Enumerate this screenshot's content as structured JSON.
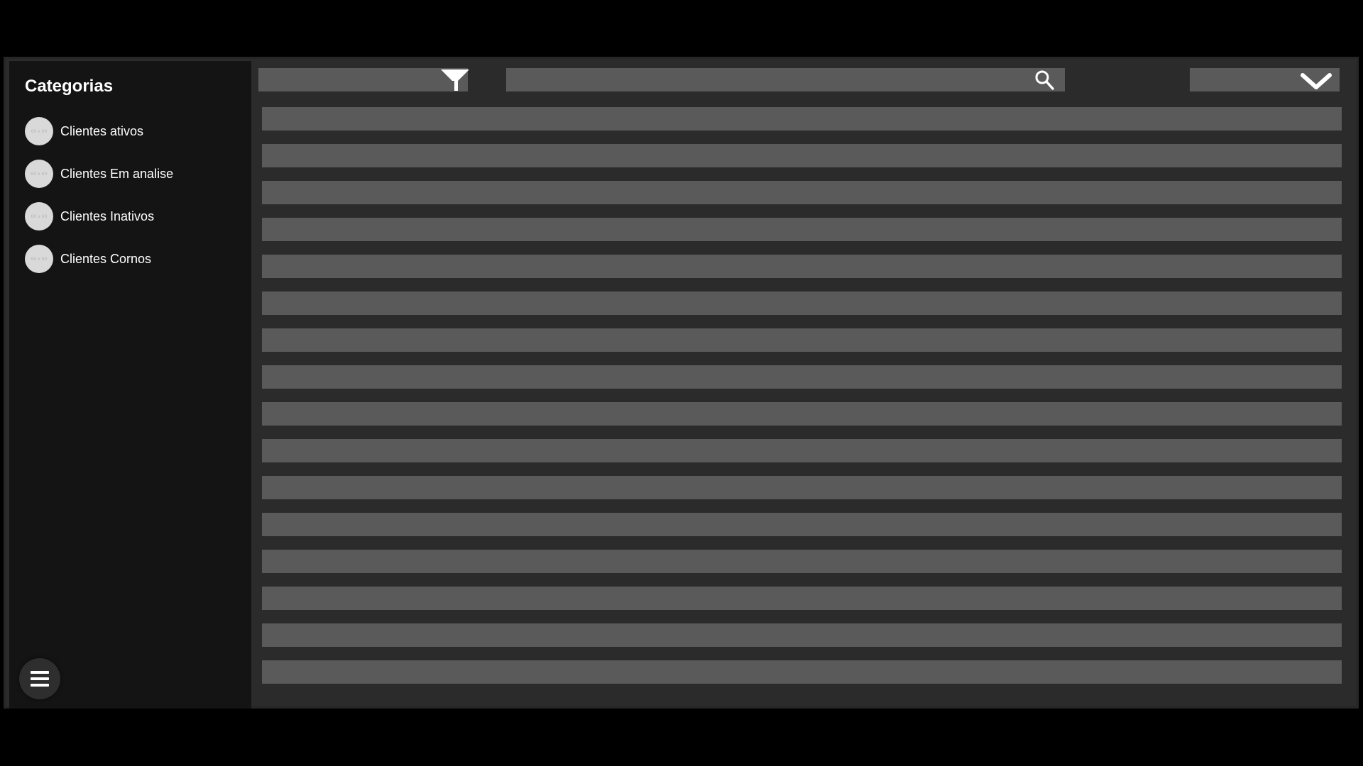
{
  "sidebar": {
    "title": "Categorias",
    "items": [
      {
        "label": "Clientes ativos",
        "avatar_text": "60 x 60"
      },
      {
        "label": "Clientes Em analise",
        "avatar_text": "60 x 60"
      },
      {
        "label": "Clientes Inativos",
        "avatar_text": "60 x 60"
      },
      {
        "label": "Clientes Cornos",
        "avatar_text": "60 x 60"
      }
    ],
    "menu_icon": "hamburger-menu-icon"
  },
  "toolbar": {
    "filter": {
      "value": "",
      "icon": "filter-icon"
    },
    "search": {
      "value": "",
      "icon": "search-icon"
    },
    "dropdown": {
      "value": "",
      "icon": "chevron-down-icon"
    }
  },
  "list": {
    "row_count": 16
  },
  "colors": {
    "page_background": "#000000",
    "app_background": "#2b2b2b",
    "sidebar_background": "#141414",
    "placeholder_bar": "#5a5a5a",
    "text": "#ffffff",
    "avatar": "#d9d9d9"
  }
}
